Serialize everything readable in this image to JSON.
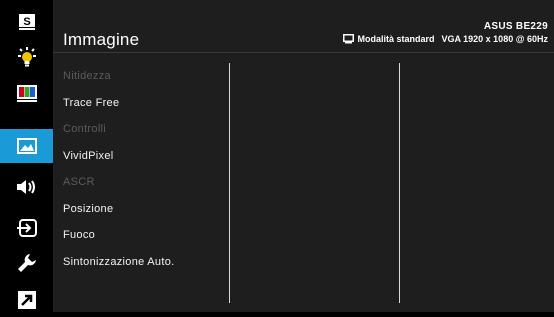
{
  "header": {
    "title": "Immagine",
    "model": "ASUS BE229",
    "mode": "Modalità standard",
    "input_info": "VGA 1920 x 1080 @ 60Hz"
  },
  "sidebar": {
    "items": [
      {
        "name": "splendid",
        "icon": "s-splendid-icon",
        "label": "S"
      },
      {
        "name": "blue-light-filter",
        "icon": "light-bulb-icon"
      },
      {
        "name": "color",
        "icon": "color-bars-icon"
      },
      {
        "name": "image",
        "icon": "picture-icon",
        "active": true
      },
      {
        "name": "sound",
        "icon": "speaker-icon"
      },
      {
        "name": "input-select",
        "icon": "input-select-icon"
      },
      {
        "name": "system-setup",
        "icon": "wrench-icon"
      },
      {
        "name": "shortcut",
        "icon": "shortcut-arrow-icon"
      }
    ]
  },
  "menu": {
    "items": [
      {
        "label": "Nitidezza",
        "disabled": true
      },
      {
        "label": "Trace Free",
        "disabled": false
      },
      {
        "label": "Controlli",
        "disabled": true
      },
      {
        "label": "VividPixel",
        "disabled": false
      },
      {
        "label": "ASCR",
        "disabled": true
      },
      {
        "label": "Posizione",
        "disabled": false
      },
      {
        "label": "Fuoco",
        "disabled": false
      },
      {
        "label": "Sintonizzazione Auto.",
        "disabled": false
      }
    ]
  },
  "colors": {
    "accent": "#1a9ad6",
    "panel": "#1e1e1e",
    "disabled_text": "#5c5c5c"
  }
}
